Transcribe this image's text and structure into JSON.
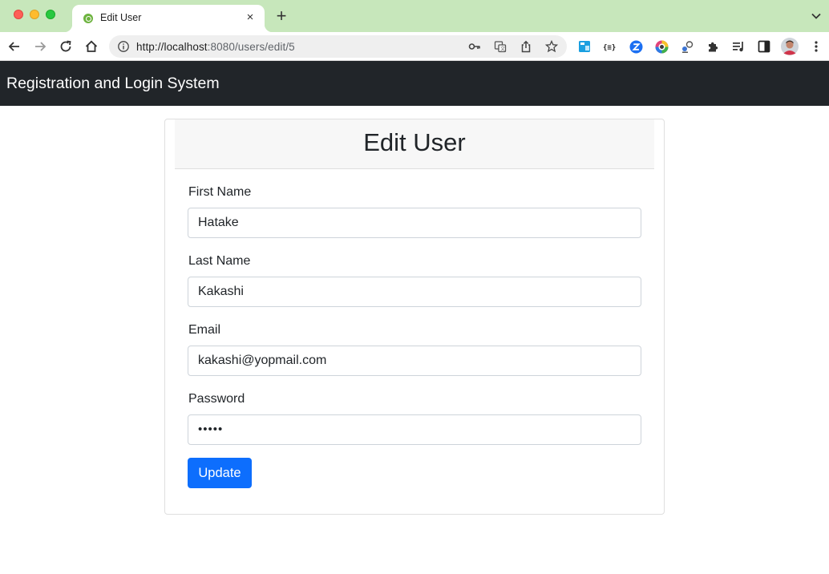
{
  "browser": {
    "tab": {
      "title": "Edit User",
      "close_glyph": "×",
      "favicon": "spring-leaf-icon"
    },
    "new_tab_glyph": "+",
    "address_bar": {
      "url_host": "http://localhost",
      "url_rest": ":8080/users/edit/5"
    },
    "toolbar_icons": [
      "back-icon",
      "forward-icon",
      "reload-icon",
      "home-icon",
      "info-icon",
      "key-icon",
      "translate-icon",
      "share-icon",
      "bookmark-star-icon"
    ],
    "extensions": [
      "extension-blue-window-icon",
      "extension-json-icon",
      "extension-z-icon",
      "extension-color-wheel-icon",
      "extension-gear-icon",
      "extensions-puzzle-icon",
      "reading-list-icon",
      "side-panel-icon",
      "profile-avatar"
    ]
  },
  "colors": {
    "tabstrip": "#c7e7bb",
    "navbar": "#212529",
    "primary_button": "#0d6efd"
  },
  "navbar": {
    "brand": "Registration and Login System"
  },
  "card": {
    "title": "Edit User"
  },
  "form": {
    "first_name": {
      "label": "First Name",
      "value": "Hatake"
    },
    "last_name": {
      "label": "Last Name",
      "value": "Kakashi"
    },
    "email": {
      "label": "Email",
      "value": "kakashi@yopmail.com"
    },
    "password": {
      "label": "Password",
      "value": "•••••"
    },
    "submit_label": "Update"
  }
}
